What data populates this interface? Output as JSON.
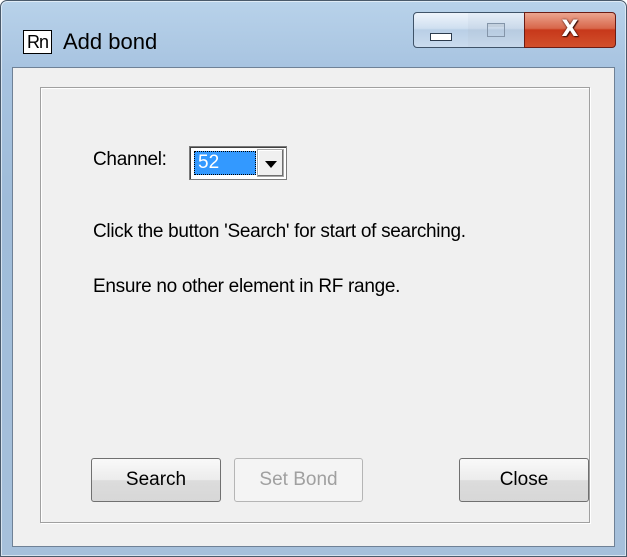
{
  "window": {
    "app_icon_text": "Rn",
    "title": "Add bond",
    "controls": {
      "minimize_icon": "minimize-icon",
      "maximize_icon": "maximize-icon",
      "close_icon": "close-icon",
      "close_glyph": "X"
    }
  },
  "form": {
    "channel_label": "Channel:",
    "channel_value": "52",
    "hint_search": "Click the button 'Search' for start of searching.",
    "hint_range": "Ensure no other element in RF range."
  },
  "buttons": {
    "search": "Search",
    "set_bond": "Set Bond",
    "set_bond_enabled": false,
    "close": "Close"
  },
  "colors": {
    "selection": "#3399ff",
    "close_button": "#c7381a",
    "disabled_text": "#a0a0a0"
  }
}
